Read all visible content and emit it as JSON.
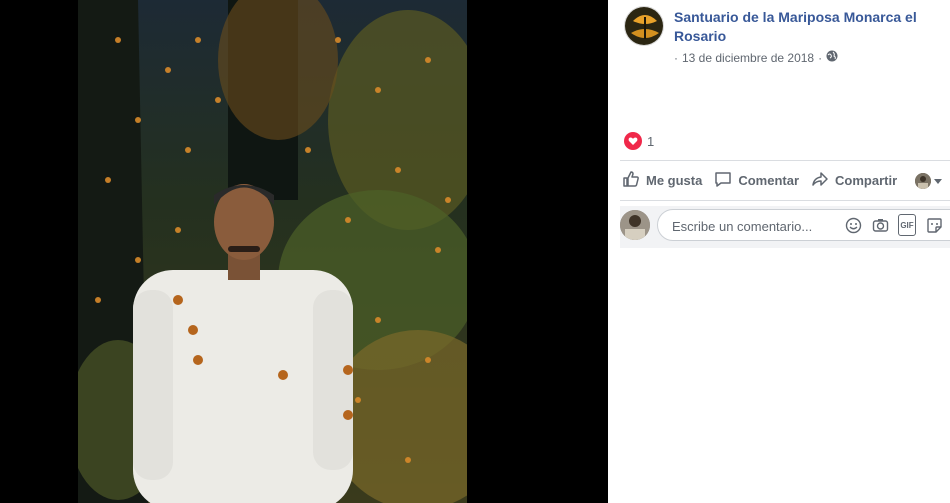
{
  "post": {
    "page_name": "Santuario de la Mariposa Monarca el Rosario",
    "date": "13 de diciembre de 2018",
    "separator": "·",
    "privacy_icon": "globe-icon"
  },
  "reactions": {
    "icon": "love-reaction-icon",
    "count": "1"
  },
  "actions": {
    "like_label": "Me gusta",
    "comment_label": "Comentar",
    "share_label": "Compartir"
  },
  "comment": {
    "placeholder": "Escribe un comentario...",
    "icons": [
      "emoji-icon",
      "camera-icon",
      "gif-icon",
      "sticker-icon"
    ]
  },
  "colors": {
    "link": "#385898",
    "meta": "#606770",
    "love": "#f0284a",
    "viewer_bg": "#000000"
  }
}
